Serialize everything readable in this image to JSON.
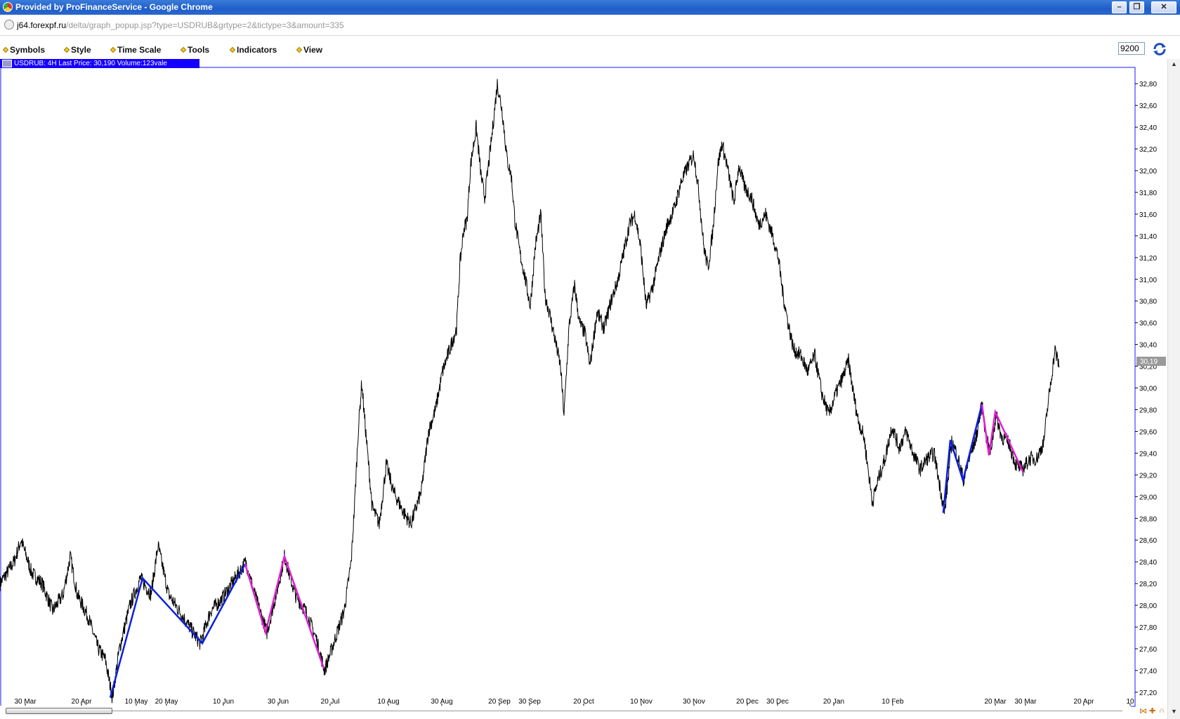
{
  "window": {
    "title": "Provided by ProFinanceService - Google Chrome"
  },
  "address_bar": {
    "host": "j64.forexpf.ru",
    "path": "/delta/graph_popup.jsp?type=USDRUB&grtype=2&tictype=3&amount=335"
  },
  "menu": {
    "items": [
      "Symbols",
      "Style",
      "Time Scale",
      "Tools",
      "Indicators",
      "View"
    ]
  },
  "amount_value": "9200",
  "info_bar": "USDRUB: 4H Last Price: 30,190 Volume:123vale",
  "colors": {
    "price_line": "#000000",
    "up_wave": "#0b1fe0",
    "down_wave": "#e020d0",
    "info_bar": "#1400ff"
  },
  "chart_data": {
    "type": "line",
    "symbol": "USDRUB",
    "timeframe": "4H",
    "last_price_label": "30,19",
    "y_ticks": [
      "27,20",
      "27,40",
      "27,60",
      "27,80",
      "28,00",
      "28,20",
      "28,40",
      "28,60",
      "28,80",
      "29,00",
      "29,20",
      "29,40",
      "29,60",
      "29,80",
      "30,00",
      "30,20",
      "30,40",
      "30,60",
      "30,80",
      "31,00",
      "31,20",
      "31,40",
      "31,60",
      "31,80",
      "32,00",
      "32,20",
      "32,40",
      "32,60",
      "32,80"
    ],
    "ylim": [
      27.07,
      32.95
    ],
    "x_ticks": [
      "30 Mar",
      "20 Apr",
      "10 May",
      "20 May",
      "10 Jun",
      "30 Jun",
      "20 Jul",
      "10 Aug",
      "30 Aug",
      "20 Sep",
      "30 Sep",
      "20 Oct",
      "10 Nov",
      "30 Nov",
      "20 Dec",
      "30 Dec",
      "20 Jan",
      "10 Feb",
      "20 Mar",
      "30 Mar",
      "20 Apr",
      "10"
    ],
    "price_anchors": [
      [
        0,
        28.2
      ],
      [
        20,
        28.4
      ],
      [
        30,
        28.6
      ],
      [
        45,
        28.3
      ],
      [
        60,
        28.2
      ],
      [
        75,
        27.95
      ],
      [
        90,
        28.1
      ],
      [
        100,
        28.45
      ],
      [
        110,
        28.1
      ],
      [
        125,
        27.9
      ],
      [
        140,
        27.6
      ],
      [
        150,
        27.5
      ],
      [
        160,
        27.15
      ],
      [
        170,
        27.6
      ],
      [
        185,
        28.0
      ],
      [
        200,
        28.25
      ],
      [
        215,
        28.1
      ],
      [
        225,
        28.55
      ],
      [
        240,
        28.1
      ],
      [
        255,
        27.95
      ],
      [
        270,
        27.8
      ],
      [
        285,
        27.65
      ],
      [
        300,
        27.95
      ],
      [
        315,
        28.05
      ],
      [
        330,
        28.2
      ],
      [
        350,
        28.4
      ],
      [
        365,
        28.05
      ],
      [
        380,
        27.75
      ],
      [
        395,
        28.15
      ],
      [
        405,
        28.45
      ],
      [
        420,
        28.1
      ],
      [
        435,
        27.95
      ],
      [
        450,
        27.7
      ],
      [
        462,
        27.4
      ],
      [
        475,
        27.65
      ],
      [
        490,
        27.95
      ],
      [
        500,
        28.4
      ],
      [
        505,
        28.95
      ],
      [
        510,
        29.6
      ],
      [
        515,
        30.05
      ],
      [
        520,
        29.65
      ],
      [
        530,
        28.9
      ],
      [
        540,
        28.75
      ],
      [
        550,
        29.3
      ],
      [
        560,
        29.05
      ],
      [
        575,
        28.85
      ],
      [
        585,
        28.75
      ],
      [
        600,
        29.05
      ],
      [
        610,
        29.6
      ],
      [
        620,
        29.8
      ],
      [
        630,
        30.15
      ],
      [
        640,
        30.35
      ],
      [
        650,
        30.55
      ],
      [
        655,
        31.15
      ],
      [
        660,
        31.45
      ],
      [
        665,
        31.55
      ],
      [
        670,
        32.05
      ],
      [
        678,
        32.4
      ],
      [
        685,
        31.95
      ],
      [
        690,
        31.75
      ],
      [
        700,
        32.3
      ],
      [
        708,
        32.8
      ],
      [
        715,
        32.55
      ],
      [
        722,
        32.1
      ],
      [
        728,
        31.95
      ],
      [
        733,
        31.55
      ],
      [
        740,
        31.25
      ],
      [
        748,
        31.0
      ],
      [
        755,
        30.75
      ],
      [
        762,
        31.3
      ],
      [
        770,
        31.6
      ],
      [
        776,
        30.85
      ],
      [
        782,
        30.7
      ],
      [
        790,
        30.45
      ],
      [
        798,
        30.2
      ],
      [
        803,
        29.75
      ],
      [
        810,
        30.55
      ],
      [
        818,
        30.95
      ],
      [
        825,
        30.6
      ],
      [
        833,
        30.5
      ],
      [
        840,
        30.2
      ],
      [
        850,
        30.7
      ],
      [
        860,
        30.55
      ],
      [
        870,
        30.8
      ],
      [
        880,
        31.0
      ],
      [
        888,
        31.25
      ],
      [
        896,
        31.5
      ],
      [
        904,
        31.6
      ],
      [
        912,
        31.3
      ],
      [
        920,
        30.75
      ],
      [
        930,
        30.95
      ],
      [
        940,
        31.25
      ],
      [
        950,
        31.5
      ],
      [
        960,
        31.65
      ],
      [
        970,
        31.9
      ],
      [
        980,
        32.05
      ],
      [
        988,
        32.15
      ],
      [
        995,
        31.8
      ],
      [
        1002,
        31.3
      ],
      [
        1008,
        31.1
      ],
      [
        1015,
        31.45
      ],
      [
        1022,
        32.05
      ],
      [
        1028,
        32.25
      ],
      [
        1035,
        32.05
      ],
      [
        1045,
        31.7
      ],
      [
        1052,
        32.05
      ],
      [
        1060,
        31.85
      ],
      [
        1070,
        31.75
      ],
      [
        1080,
        31.5
      ],
      [
        1090,
        31.6
      ],
      [
        1100,
        31.4
      ],
      [
        1108,
        31.2
      ],
      [
        1115,
        30.85
      ],
      [
        1122,
        30.6
      ],
      [
        1130,
        30.35
      ],
      [
        1140,
        30.3
      ],
      [
        1150,
        30.15
      ],
      [
        1160,
        30.3
      ],
      [
        1170,
        29.95
      ],
      [
        1180,
        29.75
      ],
      [
        1190,
        29.95
      ],
      [
        1200,
        30.1
      ],
      [
        1208,
        30.25
      ],
      [
        1215,
        29.95
      ],
      [
        1222,
        29.7
      ],
      [
        1230,
        29.55
      ],
      [
        1236,
        29.25
      ],
      [
        1242,
        28.95
      ],
      [
        1250,
        29.15
      ],
      [
        1260,
        29.35
      ],
      [
        1270,
        29.65
      ],
      [
        1280,
        29.45
      ],
      [
        1290,
        29.6
      ],
      [
        1300,
        29.4
      ],
      [
        1310,
        29.25
      ],
      [
        1320,
        29.35
      ],
      [
        1330,
        29.4
      ],
      [
        1338,
        29.1
      ],
      [
        1345,
        28.85
      ],
      [
        1355,
        29.5
      ],
      [
        1362,
        29.4
      ],
      [
        1372,
        29.15
      ],
      [
        1380,
        29.35
      ],
      [
        1390,
        29.55
      ],
      [
        1398,
        29.85
      ],
      [
        1404,
        29.55
      ],
      [
        1410,
        29.4
      ],
      [
        1418,
        29.75
      ],
      [
        1426,
        29.55
      ],
      [
        1436,
        29.5
      ],
      [
        1446,
        29.3
      ],
      [
        1456,
        29.25
      ],
      [
        1466,
        29.35
      ],
      [
        1476,
        29.35
      ],
      [
        1486,
        29.5
      ],
      [
        1492,
        29.85
      ],
      [
        1497,
        30.1
      ],
      [
        1502,
        30.35
      ],
      [
        1508,
        30.2
      ]
    ],
    "waves": [
      {
        "color": "up",
        "points": [
          [
            157,
            27.15
          ],
          [
            203,
            28.25
          ],
          [
            288,
            27.65
          ],
          [
            349,
            28.38
          ]
        ]
      },
      {
        "color": "down",
        "points": [
          [
            349,
            28.38
          ],
          [
            378,
            27.75
          ],
          [
            405,
            28.45
          ],
          [
            461,
            27.42
          ]
        ]
      },
      {
        "color": "up",
        "points": [
          [
            1343,
            28.85
          ],
          [
            1353,
            29.52
          ],
          [
            1371,
            29.15
          ],
          [
            1398,
            29.85
          ]
        ]
      },
      {
        "color": "down",
        "points": [
          [
            1398,
            29.85
          ],
          [
            1408,
            29.38
          ],
          [
            1417,
            29.78
          ],
          [
            1457,
            29.22
          ]
        ]
      }
    ]
  }
}
